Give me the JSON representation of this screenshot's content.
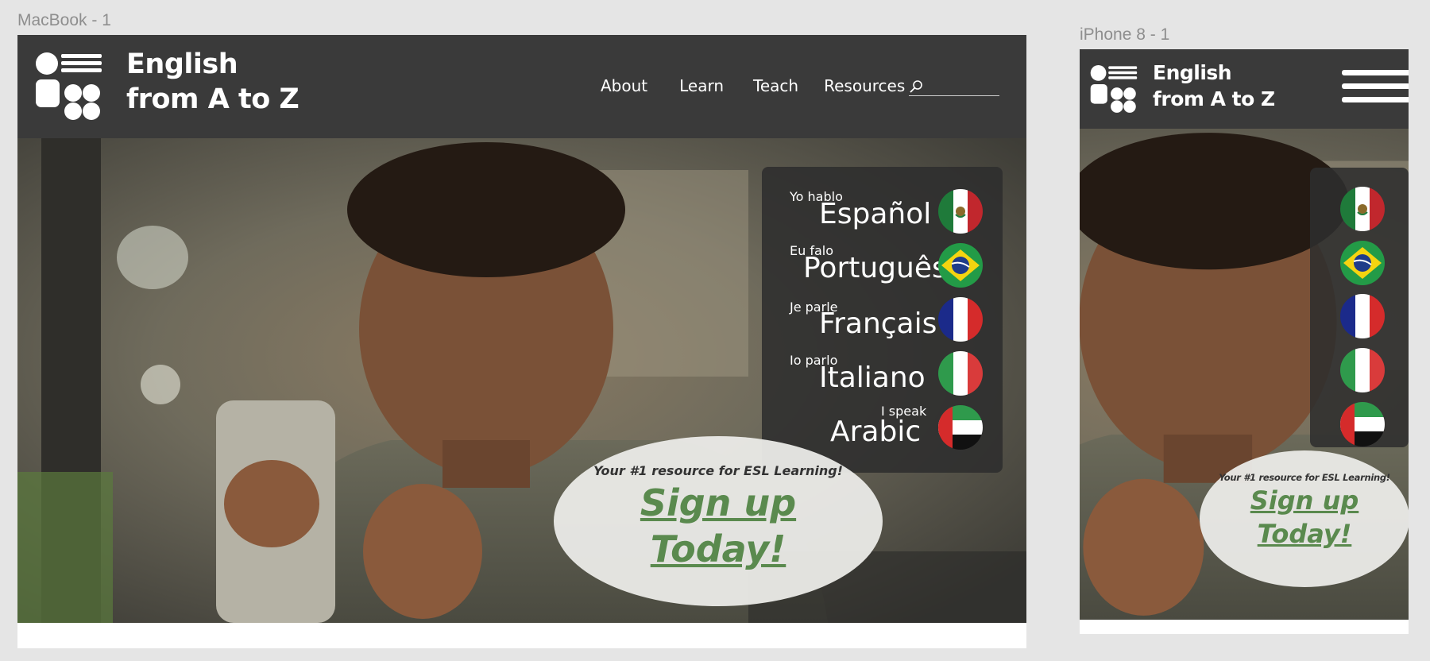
{
  "artboards": {
    "desktop_label": "MacBook - 1",
    "mobile_label": "iPhone 8 - 1"
  },
  "brand": {
    "line1": "English",
    "line2": "from A to Z"
  },
  "nav": {
    "about": "About",
    "learn": "Learn",
    "teach": "Teach",
    "resources": "Resources"
  },
  "search": {
    "placeholder": "",
    "value": ""
  },
  "languages": [
    {
      "pre": "Yo hablo",
      "name": "Español",
      "flag": "mexico-flag-icon"
    },
    {
      "pre": "Eu falo",
      "name": "Português",
      "flag": "brazil-flag-icon"
    },
    {
      "pre": "Je parle",
      "name": "Français",
      "flag": "france-flag-icon"
    },
    {
      "pre": "Io parlo",
      "name": "Italiano",
      "flag": "italy-flag-icon"
    },
    {
      "pre": "I speak",
      "name": "Arabic",
      "flag": "uae-flag-icon"
    }
  ],
  "signup": {
    "tagline": "Your #1 resource for ESL Learning!",
    "line1": "Sign up",
    "line2": "Today!"
  },
  "colors": {
    "header": "#3a3a3a",
    "accent_green": "#5a8a4e",
    "canvas": "#e5e5e5"
  }
}
